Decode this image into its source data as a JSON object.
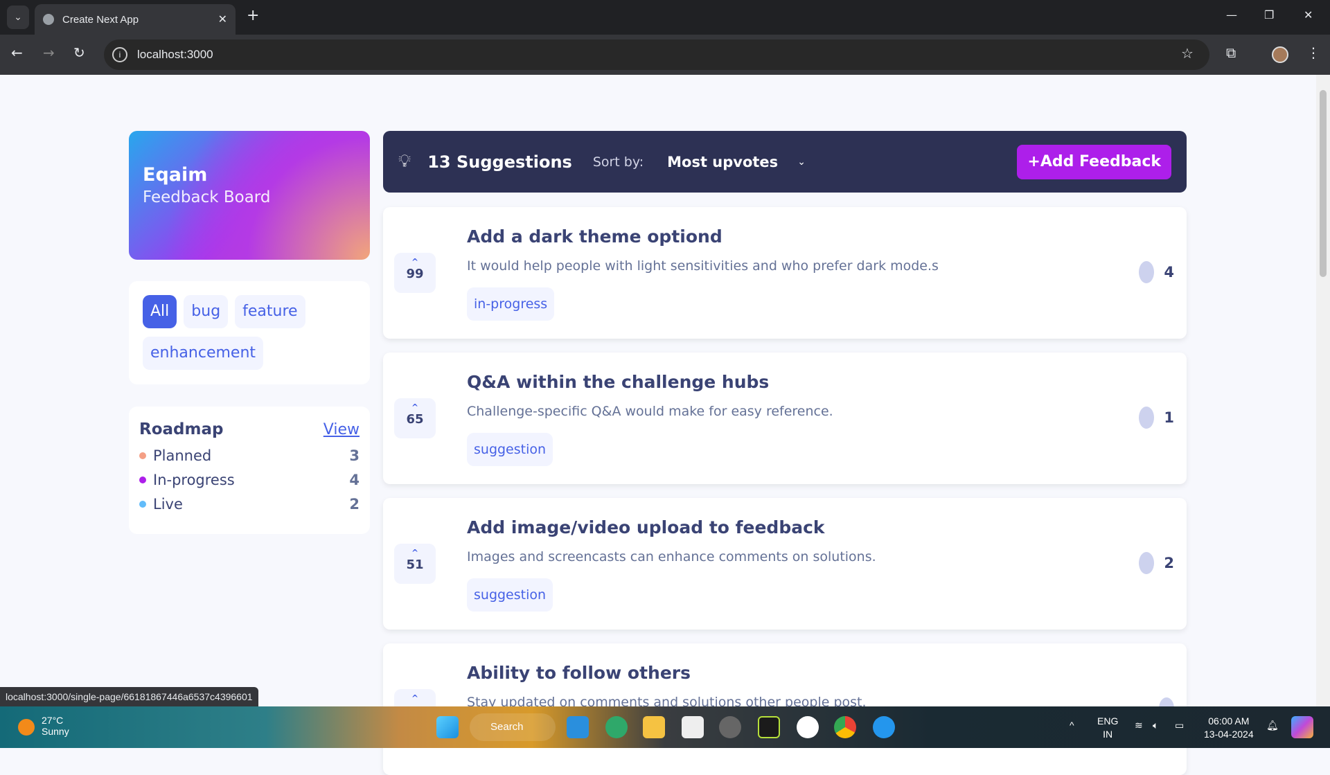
{
  "browser": {
    "tab_title": "Create Next App",
    "url": "localhost:3000",
    "status_url": "localhost:3000/single-page/66181867446a6537c4396601"
  },
  "brand": {
    "name": "Eqaim",
    "subtitle": "Feedback Board"
  },
  "filters": [
    {
      "label": "All",
      "active": true
    },
    {
      "label": "bug"
    },
    {
      "label": "feature"
    },
    {
      "label": "enhancement"
    }
  ],
  "roadmap": {
    "title": "Roadmap",
    "view_label": "View",
    "items": [
      {
        "label": "Planned",
        "count": "3",
        "color": "#f49f85"
      },
      {
        "label": "In-progress",
        "count": "4",
        "color": "#ad1fea"
      },
      {
        "label": "Live",
        "count": "2",
        "color": "#62bcfa"
      }
    ]
  },
  "header": {
    "count_label": "13 Suggestions",
    "sort_label": "Sort by:",
    "sort_value": "Most upvotes",
    "add_label": "+Add Feedback"
  },
  "suggestions": [
    {
      "title": "Add a dark theme optiond",
      "description": "It would help people with light sensitivities and who prefer dark mode.s",
      "tag": "in-progress",
      "upvotes": "99",
      "comments": "4"
    },
    {
      "title": "Q&A within the challenge hubs",
      "description": "Challenge-specific Q&A would make for easy reference.",
      "tag": "suggestion",
      "upvotes": "65",
      "comments": "1"
    },
    {
      "title": "Add image/video upload to feedback",
      "description": "Images and screencasts can enhance comments on solutions.",
      "tag": "suggestion",
      "upvotes": "51",
      "comments": "2"
    },
    {
      "title": "Ability to follow others",
      "description": "Stay updated on comments and solutions other people post.",
      "tag": "",
      "upvotes": "",
      "comments": ""
    }
  ],
  "taskbar": {
    "temp": "27°C",
    "weather": "Sunny",
    "search": "Search",
    "lang1": "ENG",
    "lang2": "IN",
    "time": "06:00 AM",
    "date": "13-04-2024"
  },
  "colors": {
    "accent": "#ad1fea",
    "blue": "#4661e6",
    "navy": "#2d3154"
  }
}
